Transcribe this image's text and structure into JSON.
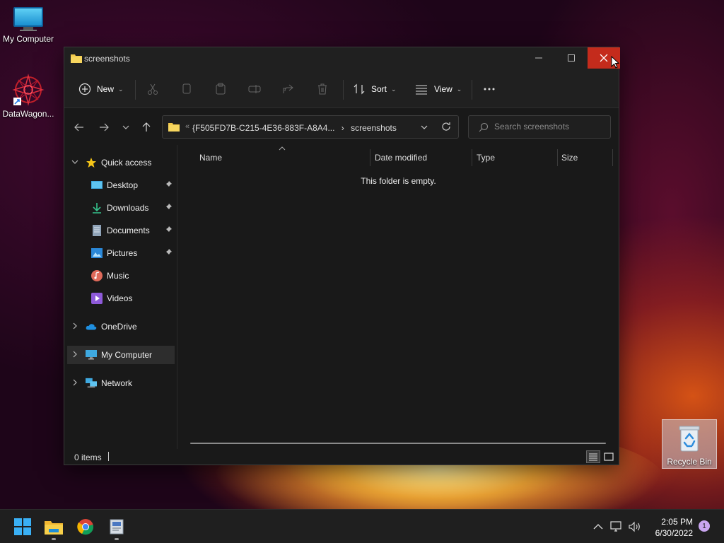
{
  "desktop": {
    "icons": [
      {
        "label": "My Computer",
        "icon": "monitor-icon"
      },
      {
        "label": "DataWagon...",
        "icon": "datawagon-logo-icon"
      }
    ],
    "recycle_bin": {
      "label": "Recycle Bin",
      "icon": "recycle-bin-icon"
    }
  },
  "window": {
    "title": "screenshots",
    "controls": {
      "minimize": "minimize-icon",
      "maximize": "maximize-icon",
      "close": "close-icon"
    },
    "close_color": "#c42b1c"
  },
  "toolbar": {
    "new_label": "New",
    "sort_label": "Sort",
    "view_label": "View",
    "icons": [
      "cut-icon",
      "copy-icon",
      "paste-icon",
      "rename-icon",
      "share-icon",
      "delete-icon",
      "more-icon"
    ]
  },
  "address": {
    "path_root": "{F505FD7B-C215-4E36-883F-A8A4...",
    "separator": "›",
    "path_current": "screenshots",
    "overflow": "«"
  },
  "search": {
    "placeholder": "Search screenshots"
  },
  "nav": {
    "quick_access": "Quick access",
    "items": [
      {
        "label": "Desktop",
        "icon": "desktop-icon",
        "pinned": true
      },
      {
        "label": "Downloads",
        "icon": "downloads-icon",
        "pinned": true
      },
      {
        "label": "Documents",
        "icon": "documents-icon",
        "pinned": true
      },
      {
        "label": "Pictures",
        "icon": "pictures-icon",
        "pinned": true
      },
      {
        "label": "Music",
        "icon": "music-icon",
        "pinned": false
      },
      {
        "label": "Videos",
        "icon": "videos-icon",
        "pinned": false
      }
    ],
    "onedrive": "OneDrive",
    "my_computer": "My Computer",
    "network": "Network"
  },
  "columns": [
    "Name",
    "Date modified",
    "Type",
    "Size"
  ],
  "empty_message": "This folder is empty.",
  "status": {
    "items_count": "0 items"
  },
  "taskbar": {
    "apps": [
      "start-icon",
      "file-explorer-icon",
      "chrome-icon",
      "app-icon"
    ],
    "tray": [
      "chevron-up-icon",
      "network-icon",
      "volume-icon"
    ],
    "time": "2:05 PM",
    "date": "6/30/2022",
    "notification_count": "1"
  }
}
